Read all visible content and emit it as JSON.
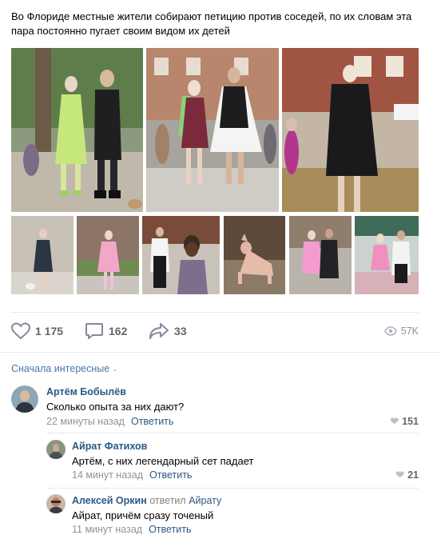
{
  "post": {
    "text": "Во Флориде местные жители собирают петицию против соседей, по их словам эта пара постоянно пугает своим видом их детей"
  },
  "photos": [
    {
      "desc": "couple-on-street-1"
    },
    {
      "desc": "couple-on-street-2"
    },
    {
      "desc": "person-in-black-dress"
    },
    {
      "desc": "thumb-1"
    },
    {
      "desc": "thumb-2"
    },
    {
      "desc": "thumb-3"
    },
    {
      "desc": "thumb-4"
    },
    {
      "desc": "thumb-5"
    },
    {
      "desc": "thumb-6"
    }
  ],
  "actions": {
    "likes": "1 175",
    "comments": "162",
    "shares": "33",
    "views": "57K",
    "icons": [
      "heart-icon",
      "comment-icon",
      "share-icon",
      "eye-icon"
    ]
  },
  "comments_sort": {
    "label": "Сначала интересные"
  },
  "comments": [
    {
      "author": "Артём Бобылёв",
      "replied": "",
      "replied_to": "",
      "text": "Сколько опыта за них дают?",
      "time": "22 минуты назад",
      "reply_label": "Ответить",
      "likes": "151"
    },
    {
      "author": "Айрат Фатихов",
      "replied": "",
      "replied_to": "",
      "text": "Артём, с них легендарный сет падает",
      "time": "14 минут назад",
      "reply_label": "Ответить",
      "likes": "21"
    },
    {
      "author": "Алексей Оркин",
      "replied": "ответил",
      "replied_to": "Айрату",
      "text": "Айрат, причём сразу точеный",
      "time": "11 минут назад",
      "reply_label": "Ответить",
      "likes": ""
    }
  ],
  "colors": {
    "link": "#2a5885",
    "muted": "#939393",
    "divider": "#e7e8ec",
    "icon": "#828a99"
  }
}
